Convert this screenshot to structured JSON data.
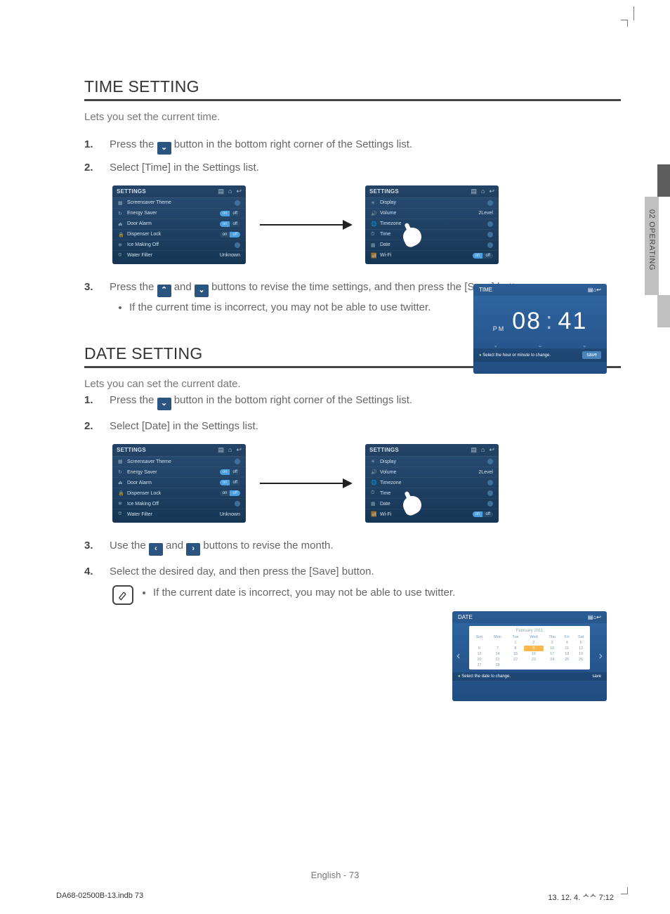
{
  "sidetab": "02  OPERATING",
  "time": {
    "heading": "TIME SETTING",
    "intro": "Lets you set the current time.",
    "step1a": "Press the",
    "step1b": "button in the bottom right corner of the Settings list.",
    "step2": "Select [Time] in the Settings list.",
    "step3a": "Press the",
    "step3b": "and",
    "step3c": "buttons to revise the time settings, and then press the [Save] button.",
    "note": "If the current time is incorrect, you may not be able to use twitter."
  },
  "date": {
    "heading": "DATE SETTING",
    "intro": "Lets you can set the current date.",
    "step1a": "Press the",
    "step1b": "button in the bottom right corner of the Settings list.",
    "step2": "Select [Date] in the Settings list.",
    "step3a": "Use the",
    "step3b": "and",
    "step3c": "buttons to revise the month.",
    "step4": "Select the desired day, and then press the [Save] button.",
    "note": "If the current date is incorrect, you may not be able to use twitter."
  },
  "panel1": {
    "title": "SETTINGS",
    "rows": [
      "Screensaver Theme",
      "Energy Saver",
      "Door Alarm",
      "Dispenser Lock",
      "Ice Making Off",
      "Water Filter"
    ],
    "on": "on",
    "off": "off",
    "unknown": "Unknown"
  },
  "panel2": {
    "title": "SETTINGS",
    "rows": [
      "Display",
      "Volume",
      "Timezone",
      "Time",
      "Date",
      "Wi-Fi"
    ],
    "level": "2Level"
  },
  "timefig": {
    "title": "TIME",
    "ampm": "PM",
    "hh": "08",
    "mm": "41",
    "tip": "Select the hour or minute to change.",
    "save": "save"
  },
  "datefig": {
    "title": "DATE",
    "month": "February 2011",
    "days": [
      "Sun",
      "Mon",
      "Tue",
      "Wed",
      "Thu",
      "Fri",
      "Sat"
    ],
    "tip": "Select the date to change.",
    "save": "save"
  },
  "footer": {
    "lang": "English - 73",
    "file": "DA68-02500B-13.indb   73",
    "stamp": "13. 12. 4.   ᄉᄉ 7:12"
  },
  "arrows": {
    "ud": "⌄",
    "uu": "⌃"
  }
}
